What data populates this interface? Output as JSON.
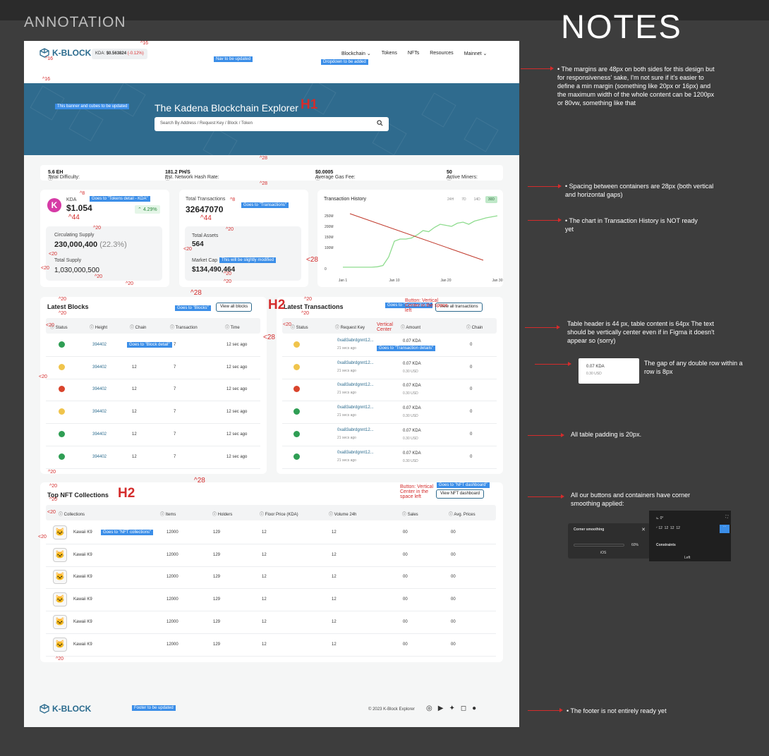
{
  "annotation_title": "ANNOTATION",
  "notes_title": "NOTES",
  "nav": {
    "logo": "K-BLOCK",
    "kda_label": "KDA:",
    "kda_price": "$0.563824",
    "kda_change": "(-0.12%)",
    "links": [
      "Blockchain",
      "Tokens",
      "NFTs",
      "Resources",
      "Mainnet"
    ],
    "nav_note": "Nav to be updated",
    "dropdown_note": "Dropdown to be added"
  },
  "banner": {
    "note": "This banner and cubes to be updated",
    "title": "The Kadena Blockchain Explorer",
    "search_placeholder": "Search By Address / Request Key / Block / Token",
    "h1_mark": "H1"
  },
  "stats": {
    "difficulty_label": "Total Difficulty:",
    "difficulty_value": "5.6 EH",
    "hashrate_label": "Est. Network Hash Rate:",
    "hashrate_value": "181.2 PH/S",
    "gas_label": "Average Gas Fee:",
    "gas_value": "$0.0005",
    "miners_label": "Active Miners:",
    "miners_value": "50"
  },
  "kda_card": {
    "symbol": "KDA",
    "price": "$1.054",
    "change": "4.29%",
    "tag": "Goes to \"Tokens detail - KDA\"",
    "circ_label": "Circulating Supply",
    "circ_value": "230,000,400",
    "circ_pct": "(22.3%)",
    "total_label": "Total Supply",
    "total_value": "1,030,000,500"
  },
  "tx_card": {
    "title": "Total Transactions",
    "value": "32647070",
    "tag": "Goes to \"Transactions\"",
    "assets_label": "Total Assets",
    "assets_value": "564",
    "cap_label": "Market Cap",
    "cap_value": "$134,490,464",
    "cap_tag": "This will be slightly modified"
  },
  "history": {
    "title": "Transaction History",
    "tabs": [
      "24H",
      "7D",
      "14D",
      "30D"
    ]
  },
  "chart_data": {
    "type": "line",
    "title": "Transaction History",
    "x": [
      "Jan 1",
      "Jan 10",
      "Jan 20",
      "Jan 30"
    ],
    "yticks": [
      "250M",
      "200M",
      "150M",
      "100M",
      "0"
    ],
    "ylim": [
      0,
      250
    ],
    "series": [
      {
        "values": [
          7,
          7,
          7,
          7,
          7,
          7,
          9,
          15,
          55,
          130,
          140,
          140,
          145,
          160,
          180,
          175,
          195,
          210,
          205,
          200,
          215,
          220,
          210,
          225,
          232,
          240,
          245,
          250
        ]
      }
    ]
  },
  "blocks": {
    "title": "Latest Blocks",
    "goes": "Goes to \"Blocks\"",
    "button": "View all blocks",
    "headers": [
      "Status",
      "Height",
      "Chain",
      "Transaction",
      "Time"
    ],
    "block_tag": "Goes to \"Block detail\"",
    "rows": [
      {
        "status": "ok",
        "height": "394402",
        "chain": "",
        "tx": "7",
        "time": "12 sec ago"
      },
      {
        "status": "pend",
        "height": "394402",
        "chain": "12",
        "tx": "7",
        "time": "12 sec ago"
      },
      {
        "status": "fail",
        "height": "394402",
        "chain": "12",
        "tx": "7",
        "time": "12 sec ago"
      },
      {
        "status": "pend",
        "height": "394402",
        "chain": "12",
        "tx": "7",
        "time": "12 sec ago"
      },
      {
        "status": "ok",
        "height": "394402",
        "chain": "12",
        "tx": "7",
        "time": "12 sec ago"
      },
      {
        "status": "ok",
        "height": "394402",
        "chain": "12",
        "tx": "7",
        "time": "12 sec ago"
      }
    ]
  },
  "transactions": {
    "title": "Latest Transactions",
    "h2": "H2",
    "goes": "Goes to \"Transactions\"",
    "button": "View all transactions",
    "headers": [
      "Status",
      "Request Key",
      "Amount",
      "Chain"
    ],
    "detail_tag": "Goes to \"Transaction details\"",
    "rows": [
      {
        "status": "pend",
        "key": "0xa83abrdgnnt12...",
        "ago": "21 secs ago",
        "amount": "0.07 KDA",
        "usd": "",
        "chain": "0"
      },
      {
        "status": "pend",
        "key": "0xa83abrdgnnt12...",
        "ago": "21 secs ago",
        "amount": "0.07 KDA",
        "usd": "0.30 USD",
        "chain": "0"
      },
      {
        "status": "fail",
        "key": "0xa83abrdgnnt12...",
        "ago": "21 secs ago",
        "amount": "0.07 KDA",
        "usd": "0.30 USD",
        "chain": "0"
      },
      {
        "status": "ok",
        "key": "0xa83abrdgnnt12...",
        "ago": "21 secs ago",
        "amount": "0.07 KDA",
        "usd": "0.30 USD",
        "chain": "0"
      },
      {
        "status": "ok",
        "key": "0xa83abrdgnnt12...",
        "ago": "21 secs ago",
        "amount": "0.07 KDA",
        "usd": "0.30 USD",
        "chain": "0"
      },
      {
        "status": "ok",
        "key": "0xa83abrdgnnt12...",
        "ago": "21 secs ago",
        "amount": "0.07 KDA",
        "usd": "0.30 USD",
        "chain": "0"
      }
    ]
  },
  "nft": {
    "title": "Top NFT Collections",
    "h2": "H2",
    "goes": "Goes to \"NFT dashboard\"",
    "button": "View NFT dashboard",
    "row_tag": "Goes to \"NFT collections\"",
    "headers": [
      "Collections",
      "Items",
      "Holders",
      "Floor Price (KDA)",
      "Volume 24h",
      "Sales",
      "Avg. Prices"
    ],
    "rows": [
      {
        "name": "Kawaii K9",
        "items": "12000",
        "holders": "129",
        "floor": "12",
        "volume": "12",
        "sales": "00",
        "avg": "00"
      },
      {
        "name": "Kawaii K9",
        "items": "12000",
        "holders": "129",
        "floor": "12",
        "volume": "12",
        "sales": "00",
        "avg": "00"
      },
      {
        "name": "Kawaii K9",
        "items": "12000",
        "holders": "129",
        "floor": "12",
        "volume": "12",
        "sales": "00",
        "avg": "00"
      },
      {
        "name": "Kawaii K9",
        "items": "12000",
        "holders": "129",
        "floor": "12",
        "volume": "12",
        "sales": "00",
        "avg": "00"
      },
      {
        "name": "Kawaii K9",
        "items": "12000",
        "holders": "129",
        "floor": "12",
        "volume": "12",
        "sales": "00",
        "avg": "00"
      },
      {
        "name": "Kawaii K9",
        "items": "12000",
        "holders": "129",
        "floor": "12",
        "volume": "12",
        "sales": "00",
        "avg": "00"
      }
    ]
  },
  "footer": {
    "logo": "K-BLOCK",
    "note": "Footer to be updated",
    "copyright": "© 2023 K-Block Explorer"
  },
  "annotations": {
    "button_vc": "Button: Vertical Center in the space left",
    "vertical_center": "Vertical Center"
  },
  "notes": {
    "margins": "The margins are 48px on both sides for this design but for responsiveness' sake, I'm not sure if it's easier to define a min margin (something like 20px or 16px) and the maximum width of the whole content can be 1200px or 80vw, something like that",
    "spacing": "Spacing between containers are 28px (both vertical and horizontal gaps)",
    "chart": "The chart in Transaction History is NOT ready yet",
    "table": "Table header is 44 px, table content is 64px The text should be vertically center even if in Figma it doesn't appear so (sorry)",
    "double_row": "The gap of any double row within a row is 8px",
    "sample_amount": "0.07 KDA",
    "sample_usd": "0.30 USD",
    "padding": "All table padding is 20px.",
    "corners": "All our buttons and containers have corner smoothing applied:",
    "cs_label": "Corner smoothing",
    "cs_value": "60%",
    "cs_ios": "iOS",
    "constraints": "Constraints",
    "left": "Left",
    "footer": "The footer is not entirely ready yet"
  }
}
